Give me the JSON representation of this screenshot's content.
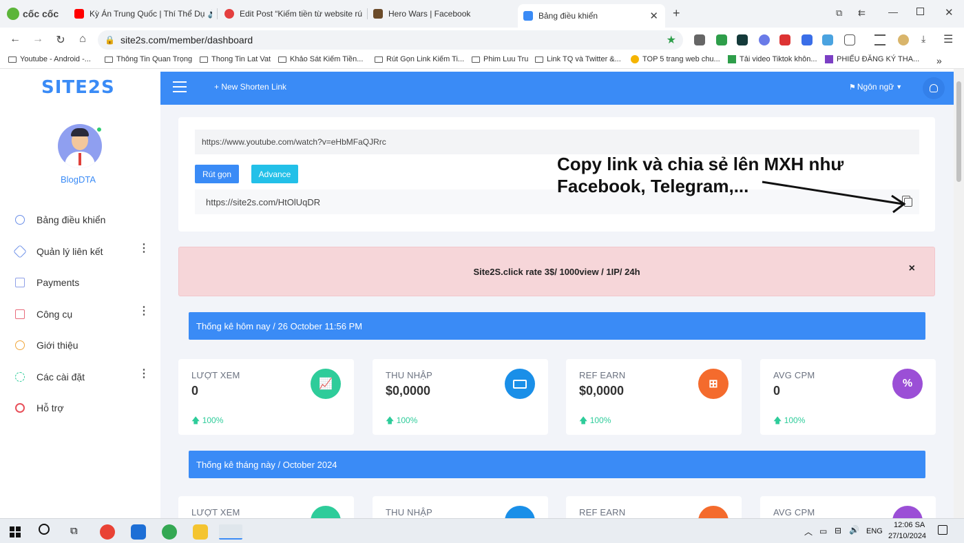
{
  "browser": {
    "brand": "cốc cốc",
    "tabs": [
      {
        "title": "Kỳ Án Trung Quốc | Thí Thể Dụ",
        "color": "#ff0000"
      },
      {
        "title": "Edit Post “Kiếm tiền từ website rút",
        "color": "#e43f3f"
      },
      {
        "title": "Hero Wars | Facebook",
        "color": "#6b4b2a"
      },
      {
        "title": "Bảng điều khiển",
        "color": "#3a8bf6"
      }
    ],
    "url": "site2s.com/member/dashboard",
    "bookmarks": [
      "Youtube - Android -...",
      "Thông Tin Quan Trọng",
      "Thong Tin Lat Vat",
      "Khảo Sát Kiếm Tiền...",
      "Rút Gọn Link Kiếm Ti...",
      "Phim Luu Tru",
      "Link TQ và Twitter &...",
      "TOP 5 trang web chu...",
      "Tải video Tiktok khôn...",
      "PHIẾU ĐĂNG KÝ THA..."
    ]
  },
  "sidebar": {
    "logo": "SITE2S",
    "username": "BlogDTA",
    "items": [
      {
        "label": "Bảng điều khiển",
        "has_menu": false
      },
      {
        "label": "Quản lý liên kết",
        "has_menu": true
      },
      {
        "label": "Payments",
        "has_menu": false
      },
      {
        "label": "Công cụ",
        "has_menu": true
      },
      {
        "label": "Giới thiệu",
        "has_menu": false
      },
      {
        "label": "Các cài đặt",
        "has_menu": true
      },
      {
        "label": "Hỗ trợ",
        "has_menu": false
      }
    ]
  },
  "topnav": {
    "new_link": "+ New Shorten Link",
    "language": "Ngôn ngữ"
  },
  "shortener": {
    "long_url": "https://www.youtube.com/watch?v=eHbMFaQJRrc",
    "shorten_label": "Rút gọn",
    "advance_label": "Advance",
    "short_url": "https://site2s.com/HtOlUqDR",
    "annotation": "Copy link và chia sẻ lên MXH như Facebook, Telegram,..."
  },
  "alert": {
    "text": "Site2S.click rate 3$/ 1000view / 1IP/ 24h",
    "close": "×"
  },
  "today": {
    "header": "Thống kê hôm nay  /  26 October 11:56 PM",
    "stats": [
      {
        "title": "LƯỢT XEM",
        "value": "0",
        "trend": "100%",
        "color": "#2ecc9a",
        "icon": "chart-icon"
      },
      {
        "title": "THU NHẬP",
        "value": "$0,0000",
        "trend": "100%",
        "color": "#1a8fe8",
        "icon": "money-icon"
      },
      {
        "title": "REF EARN",
        "value": "$0,0000",
        "trend": "100%",
        "color": "#f46b2d",
        "icon": "network-icon"
      },
      {
        "title": "AVG CPM",
        "value": "0",
        "trend": "100%",
        "color": "#9b4fd6",
        "icon": "percent-icon"
      }
    ]
  },
  "month": {
    "header": "Thống kê tháng này  /  October 2024",
    "stats": [
      {
        "title": "LƯỢT XEM"
      },
      {
        "title": "THU NHẬP"
      },
      {
        "title": "REF EARN"
      },
      {
        "title": "AVG CPM"
      }
    ]
  },
  "taskbar": {
    "lang": "ENG",
    "time": "12:06 SA",
    "date": "27/10/2024"
  }
}
